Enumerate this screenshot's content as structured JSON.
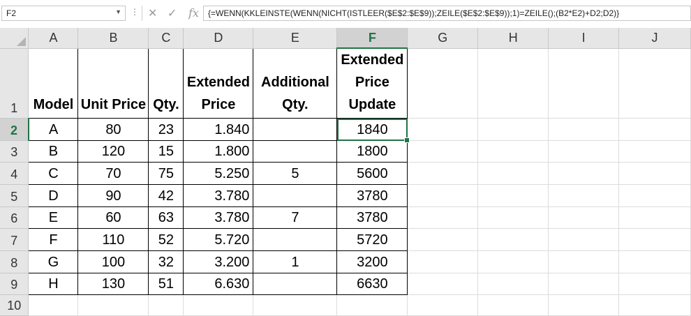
{
  "name_box": {
    "value": "F2"
  },
  "formula_bar": {
    "formula": "{=WENN(KKLEINSTE(WENN(NICHT(ISTLEER($E$2:$E$9));ZEILE($E$2:$E$9));1)=ZEILE();(B2*E2)+D2;D2)}",
    "fx_label": "fx",
    "cancel_glyph": "✕",
    "enter_glyph": "✓"
  },
  "columns": [
    "A",
    "B",
    "C",
    "D",
    "E",
    "F",
    "G",
    "H",
    "I",
    "J"
  ],
  "rows": [
    "1",
    "2",
    "3",
    "4",
    "5",
    "6",
    "7",
    "8",
    "9",
    "10"
  ],
  "selected": {
    "column": "F",
    "row": "2"
  },
  "headers": {
    "A": [
      "Model"
    ],
    "B": [
      "Unit Price"
    ],
    "C": [
      "Qty."
    ],
    "D": [
      "Extended",
      "Price"
    ],
    "E": [
      "Additional",
      "Qty."
    ],
    "F": [
      "Extended",
      "Price",
      "Update"
    ]
  },
  "data_rows": [
    {
      "model": "A",
      "unit_price": "80",
      "qty": "23",
      "extended_price": "1.840",
      "additional_qty": "",
      "update": "1840"
    },
    {
      "model": "B",
      "unit_price": "120",
      "qty": "15",
      "extended_price": "1.800",
      "additional_qty": "",
      "update": "1800"
    },
    {
      "model": "C",
      "unit_price": "70",
      "qty": "75",
      "extended_price": "5.250",
      "additional_qty": "5",
      "update": "5600"
    },
    {
      "model": "D",
      "unit_price": "90",
      "qty": "42",
      "extended_price": "3.780",
      "additional_qty": "",
      "update": "3780"
    },
    {
      "model": "E",
      "unit_price": "60",
      "qty": "63",
      "extended_price": "3.780",
      "additional_qty": "7",
      "update": "3780"
    },
    {
      "model": "F",
      "unit_price": "110",
      "qty": "52",
      "extended_price": "5.720",
      "additional_qty": "",
      "update": "5720"
    },
    {
      "model": "G",
      "unit_price": "100",
      "qty": "32",
      "extended_price": "3.200",
      "additional_qty": "1",
      "update": "3200"
    },
    {
      "model": "H",
      "unit_price": "130",
      "qty": "51",
      "extended_price": "6.630",
      "additional_qty": "",
      "update": "6630"
    }
  ],
  "colors": {
    "accent": "#217346",
    "header_bg": "#e6e6e6",
    "selected_header_bg": "#d2d2d2"
  }
}
